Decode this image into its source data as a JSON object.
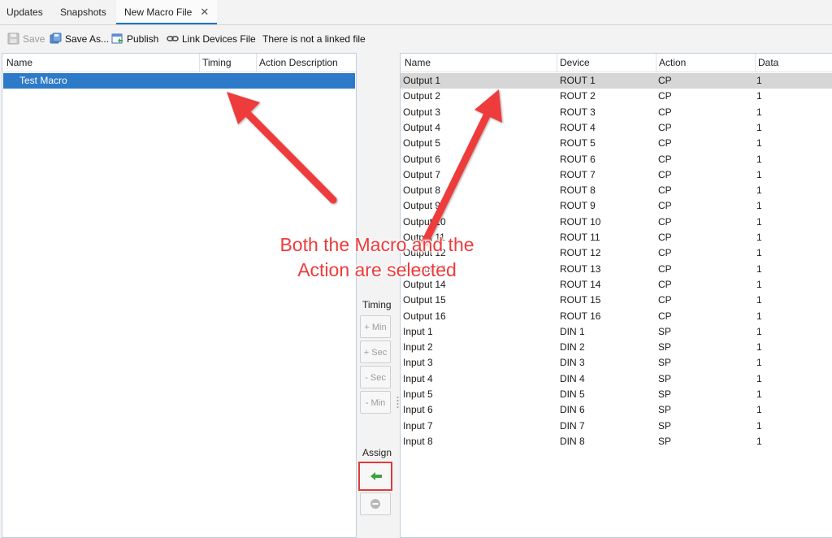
{
  "tabs": [
    {
      "label": "Updates"
    },
    {
      "label": "Snapshots"
    },
    {
      "label": "New Macro File",
      "close": "✕"
    }
  ],
  "toolbar": {
    "save": "Save",
    "save_as": "Save As...",
    "publish": "Publish",
    "link_devices": "Link Devices File",
    "link_status": "There is not a linked file"
  },
  "macros": {
    "columns": [
      "Name",
      "Timing",
      "Action Description"
    ],
    "rows": [
      {
        "name": "Test Macro",
        "timing": "",
        "action_description": ""
      }
    ]
  },
  "actions": {
    "columns": [
      "Name",
      "Device",
      "Action",
      "Data"
    ],
    "rows": [
      {
        "name": "Output 1",
        "device": "ROUT 1",
        "action": "CP",
        "data": "1"
      },
      {
        "name": "Output 2",
        "device": "ROUT 2",
        "action": "CP",
        "data": "1"
      },
      {
        "name": "Output 3",
        "device": "ROUT 3",
        "action": "CP",
        "data": "1"
      },
      {
        "name": "Output 4",
        "device": "ROUT 4",
        "action": "CP",
        "data": "1"
      },
      {
        "name": "Output 5",
        "device": "ROUT 5",
        "action": "CP",
        "data": "1"
      },
      {
        "name": "Output 6",
        "device": "ROUT 6",
        "action": "CP",
        "data": "1"
      },
      {
        "name": "Output 7",
        "device": "ROUT 7",
        "action": "CP",
        "data": "1"
      },
      {
        "name": "Output 8",
        "device": "ROUT 8",
        "action": "CP",
        "data": "1"
      },
      {
        "name": "Output 9",
        "device": "ROUT 9",
        "action": "CP",
        "data": "1"
      },
      {
        "name": "Output 10",
        "device": "ROUT 10",
        "action": "CP",
        "data": "1"
      },
      {
        "name": "Output 11",
        "device": "ROUT 11",
        "action": "CP",
        "data": "1"
      },
      {
        "name": "Output 12",
        "device": "ROUT 12",
        "action": "CP",
        "data": "1"
      },
      {
        "name": "Output 13",
        "device": "ROUT 13",
        "action": "CP",
        "data": "1"
      },
      {
        "name": "Output 14",
        "device": "ROUT 14",
        "action": "CP",
        "data": "1"
      },
      {
        "name": "Output 15",
        "device": "ROUT 15",
        "action": "CP",
        "data": "1"
      },
      {
        "name": "Output 16",
        "device": "ROUT 16",
        "action": "CP",
        "data": "1"
      },
      {
        "name": "Input 1",
        "device": "DIN 1",
        "action": "SP",
        "data": "1"
      },
      {
        "name": "Input 2",
        "device": "DIN 2",
        "action": "SP",
        "data": "1"
      },
      {
        "name": "Input 3",
        "device": "DIN 3",
        "action": "SP",
        "data": "1"
      },
      {
        "name": "Input 4",
        "device": "DIN 4",
        "action": "SP",
        "data": "1"
      },
      {
        "name": "Input 5",
        "device": "DIN 5",
        "action": "SP",
        "data": "1"
      },
      {
        "name": "Input 6",
        "device": "DIN 6",
        "action": "SP",
        "data": "1"
      },
      {
        "name": "Input 7",
        "device": "DIN 7",
        "action": "SP",
        "data": "1"
      },
      {
        "name": "Input 8",
        "device": "DIN 8",
        "action": "SP",
        "data": "1"
      }
    ]
  },
  "timing_controls": {
    "label": "Timing",
    "plus_min": "+ Min",
    "plus_sec": "+ Sec",
    "minus_sec": "- Sec",
    "minus_min": "- Min"
  },
  "assign": {
    "label": "Assign"
  },
  "annotation": {
    "text": "Both the Macro and the Action are selected"
  },
  "colors": {
    "selection_blue": "#2d7ac8",
    "selection_gray": "#d6d6d6",
    "annotation_red": "#ee3b3b",
    "tab_accent": "#1e73c8",
    "assign_arrow_green": "#3da33d"
  },
  "icons": {
    "save": "floppy-disk-icon",
    "save_as": "save-as-icon",
    "publish": "publish-icon",
    "link": "chain-link-icon",
    "assign": "arrow-left-icon",
    "remove": "minus-circle-icon"
  }
}
